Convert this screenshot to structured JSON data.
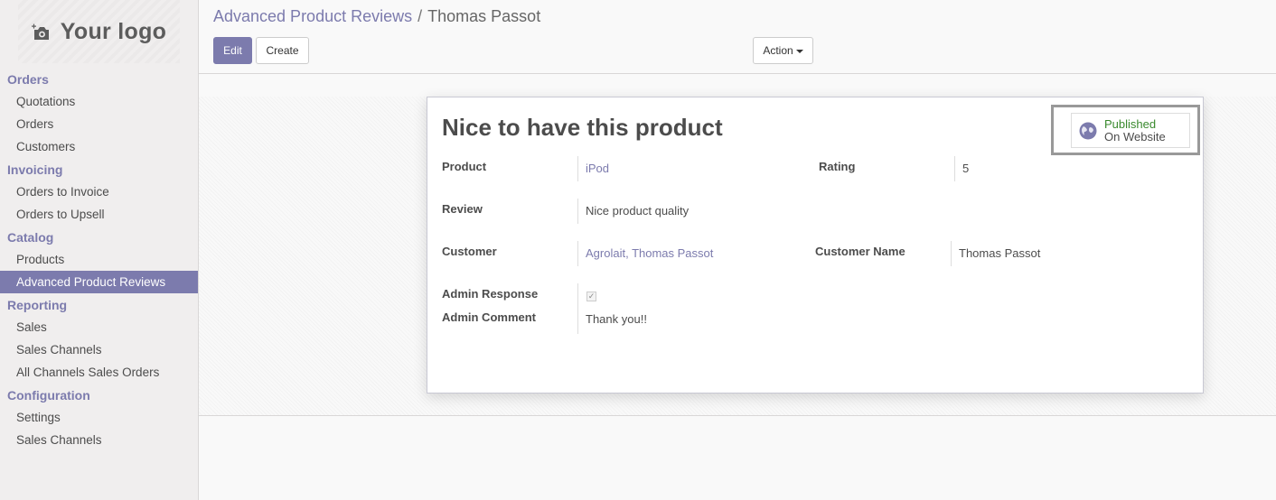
{
  "logo": {
    "text": "Your logo",
    "icon": "camera-plus-icon"
  },
  "sidebar": {
    "sections": [
      {
        "title": "Orders",
        "items": [
          {
            "label": "Quotations"
          },
          {
            "label": "Orders"
          },
          {
            "label": "Customers"
          }
        ]
      },
      {
        "title": "Invoicing",
        "items": [
          {
            "label": "Orders to Invoice"
          },
          {
            "label": "Orders to Upsell"
          }
        ]
      },
      {
        "title": "Catalog",
        "items": [
          {
            "label": "Products"
          },
          {
            "label": "Advanced Product Reviews",
            "active": true
          }
        ]
      },
      {
        "title": "Reporting",
        "items": [
          {
            "label": "Sales"
          },
          {
            "label": "Sales Channels"
          },
          {
            "label": "All Channels Sales Orders"
          }
        ]
      },
      {
        "title": "Configuration",
        "items": [
          {
            "label": "Settings"
          },
          {
            "label": "Sales Channels"
          }
        ]
      }
    ]
  },
  "breadcrumb": {
    "parent": "Advanced Product Reviews",
    "separator": "/",
    "current": "Thomas Passot"
  },
  "toolbar": {
    "edit_label": "Edit",
    "create_label": "Create",
    "action_label": "Action"
  },
  "record": {
    "title": "Nice to have this product",
    "published": {
      "line1": "Published",
      "line2": "On Website",
      "icon": "globe-icon"
    },
    "product": {
      "label": "Product",
      "value": "iPod"
    },
    "rating": {
      "label": "Rating",
      "value": "5"
    },
    "review": {
      "label": "Review",
      "value": "Nice product quality"
    },
    "customer": {
      "label": "Customer",
      "value": "Agrolait, Thomas Passot"
    },
    "customer_name": {
      "label": "Customer Name",
      "value": "Thomas Passot"
    },
    "admin_response": {
      "label": "Admin Response",
      "checked": true
    },
    "admin_comment": {
      "label": "Admin Comment",
      "value": "Thank you!!"
    }
  },
  "colors": {
    "accent": "#7c7bad",
    "published": "#3a8a2e"
  }
}
